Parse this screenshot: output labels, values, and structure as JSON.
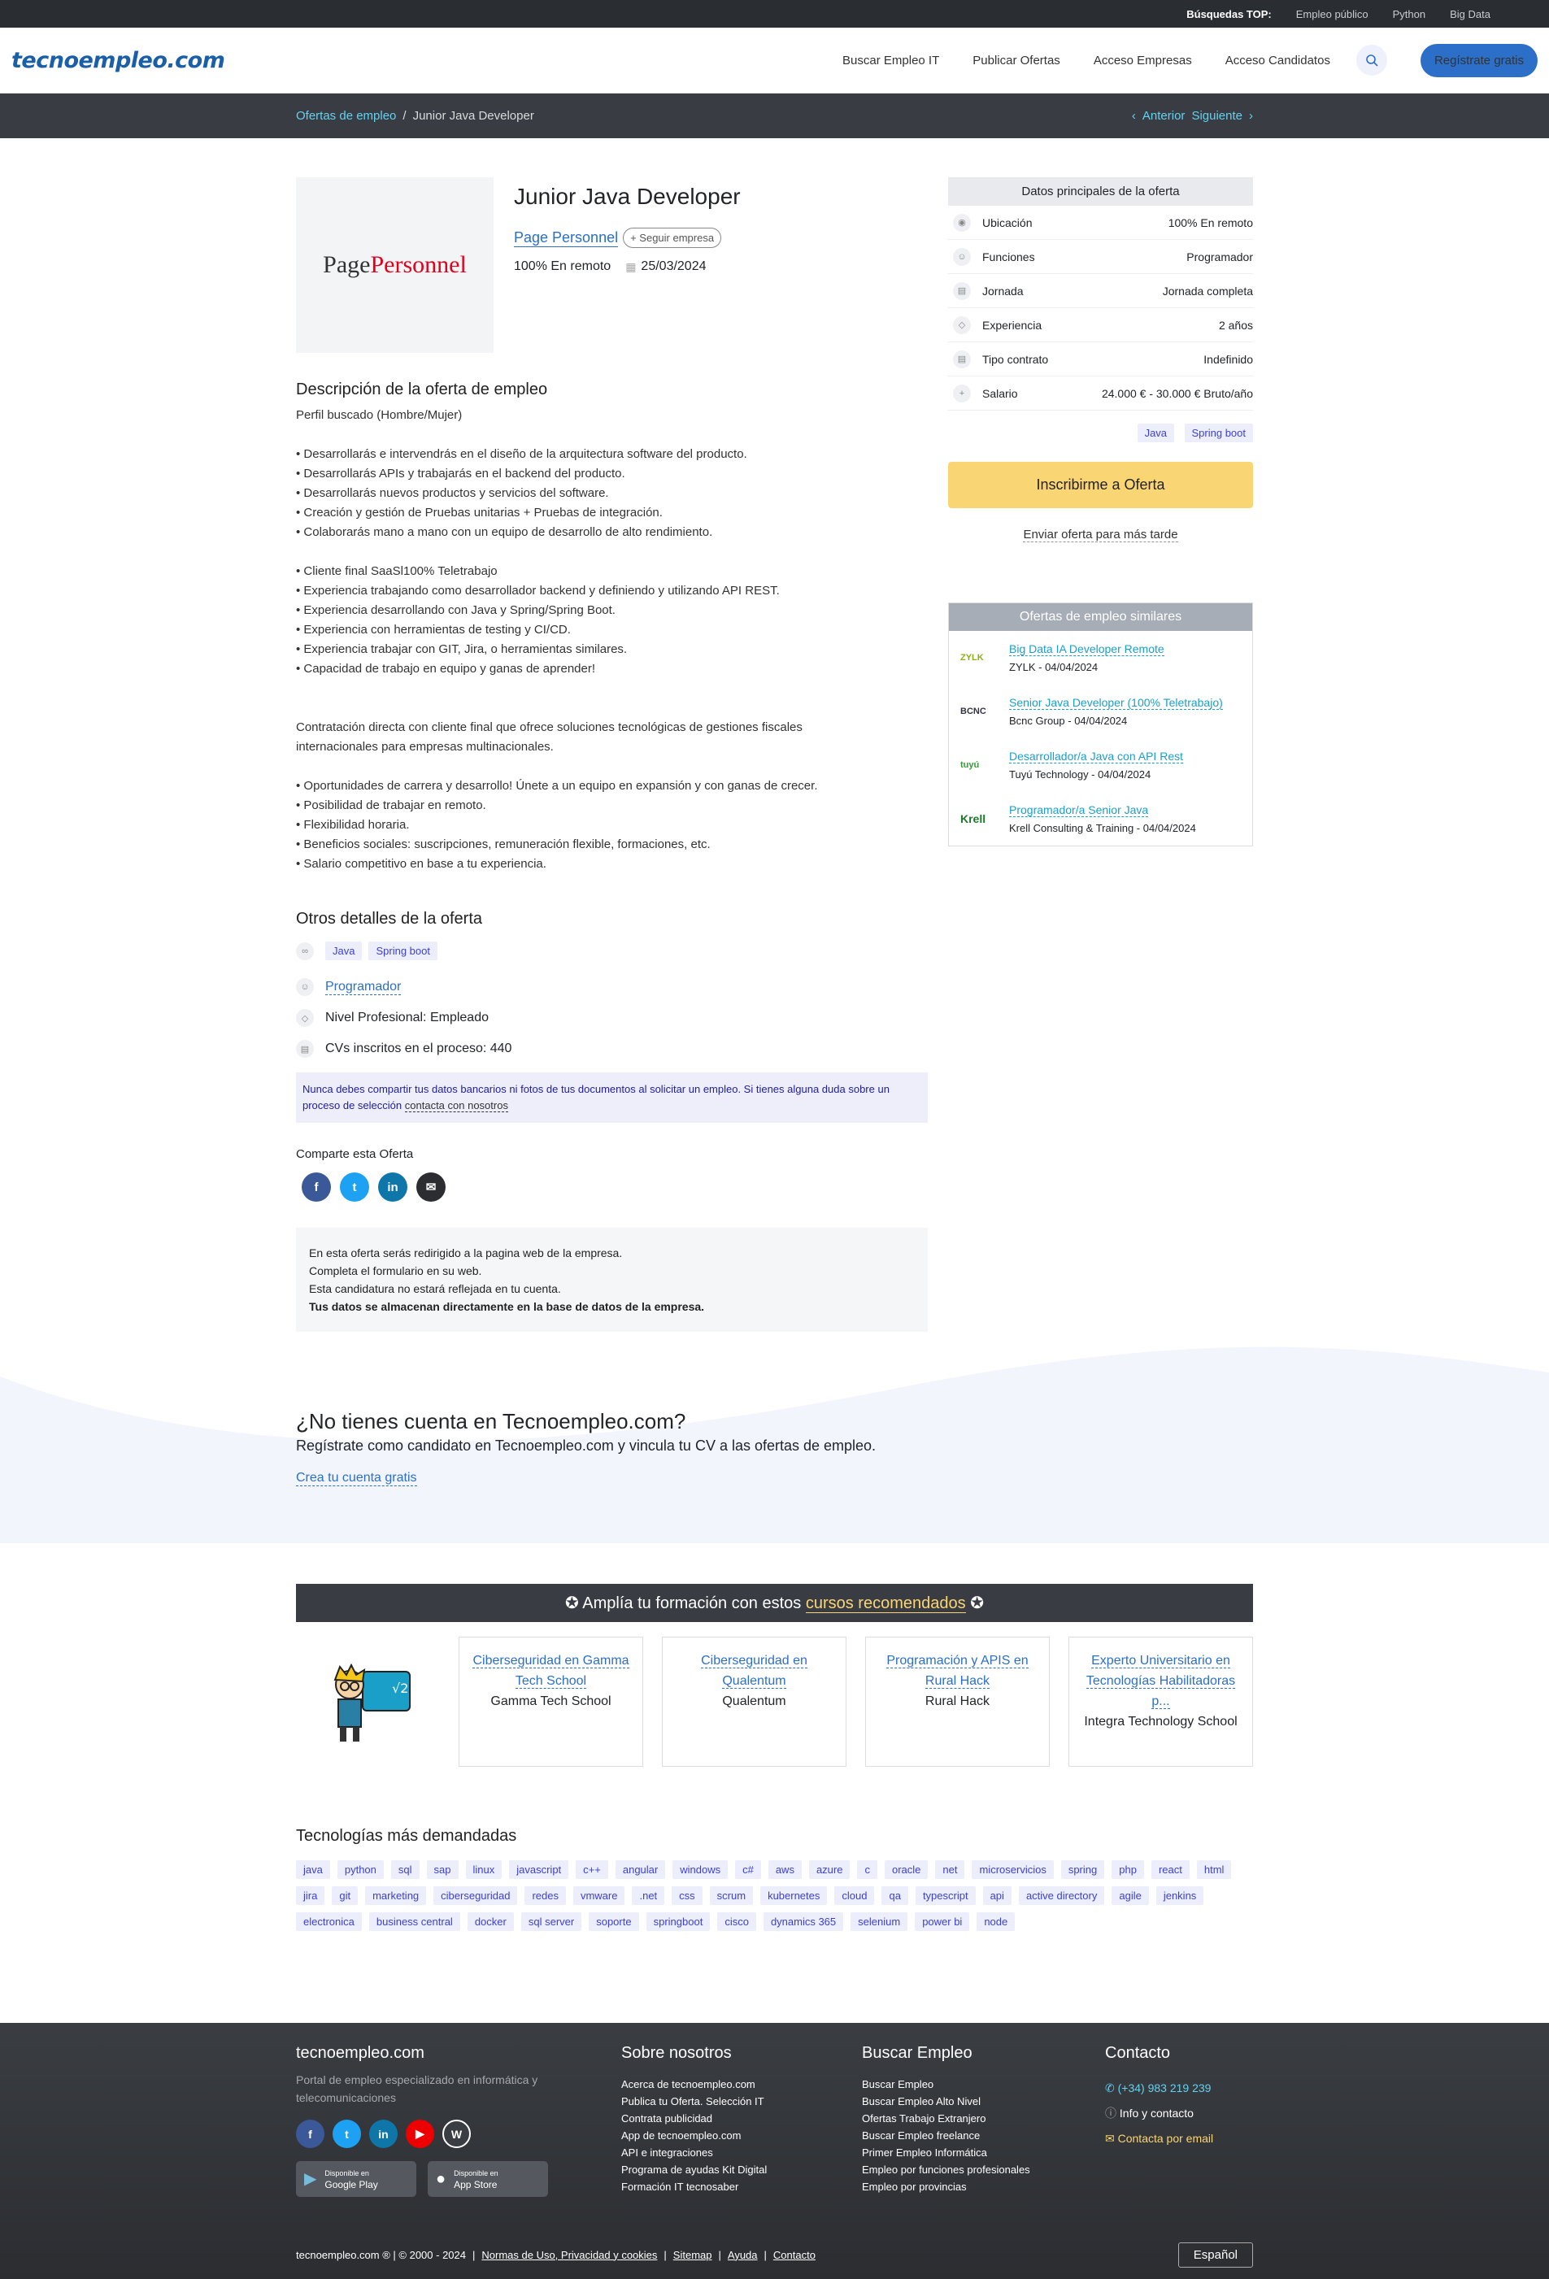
{
  "topbar": {
    "label": "Búsquedas TOP:",
    "links": [
      "Empleo público",
      "Python",
      "Big Data"
    ]
  },
  "header": {
    "logo": "tecnoempleo.com",
    "nav": [
      "Buscar Empleo IT",
      "Publicar Ofertas",
      "Acceso Empresas",
      "Acceso Candidatos"
    ],
    "register": "Regístrate gratis"
  },
  "breadcrumb": {
    "root": "Ofertas de empleo",
    "sep": "/",
    "current": "Junior Java Developer",
    "prev": "Anterior",
    "next": "Siguiente"
  },
  "job": {
    "title": "Junior Java Developer",
    "company": "Page Personnel",
    "logo_a": "Page",
    "logo_b": "Personnel",
    "follow": "+ Seguir empresa",
    "mode": "100% En remoto",
    "date": "25/03/2024"
  },
  "description": {
    "heading": "Descripción de la oferta de empleo",
    "profile": "Perfil buscado (Hombre/Mujer)",
    "block1": [
      "• Desarrollarás e intervendrás en el diseño de la arquitectura software del producto.",
      "• Desarrollarás APIs y trabajarás en el backend del producto.",
      "• Desarrollarás nuevos productos y servicios del software.",
      "• Creación y gestión de Pruebas unitarias + Pruebas de integración.",
      "• Colaborarás mano a mano con un equipo de desarrollo de alto rendimiento."
    ],
    "block2": [
      "• Cliente final SaaSl100% Teletrabajo",
      "• Experiencia trabajando como desarrollador backend y definiendo y utilizando API REST.",
      "• Experiencia desarrollando con Java y Spring/Spring Boot.",
      "• Experiencia con herramientas de testing y CI/CD.",
      "• Experiencia trabajar con GIT, Jira, o herramientas similares.",
      "• Capacidad de trabajo en equipo y ganas de aprender!"
    ],
    "block3": [
      "Contratación directa con cliente final que ofrece soluciones tecnológicas de gestiones fiscales",
      "internacionales para empresas multinacionales."
    ],
    "block4": [
      "• Oportunidades de carrera y desarrollo! Únete a un equipo en expansión y con ganas de crecer.",
      "• Posibilidad de trabajar en remoto.",
      "• Flexibilidad horaria.",
      "• Beneficios sociales: suscripciones, remuneración flexible, formaciones, etc.",
      "• Salario competitivo en base a tu experiencia."
    ]
  },
  "other": {
    "heading": "Otros detalles de la oferta",
    "tags": [
      "Java",
      "Spring boot"
    ],
    "role": "Programador",
    "level": "Nivel Profesional: Empleado",
    "cvs": "CVs inscritos en el proceso: 440",
    "warning": "Nunca debes compartir tus datos bancarios ni fotos de tus documentos al solicitar un empleo. Si tienes alguna duda sobre un proceso de selección",
    "warning_link": "contacta con nosotros",
    "share": "Comparte esta Oferta",
    "redirect": [
      "En esta oferta serás redirigido a la pagina web de la empresa.",
      "Completa el formulario en su web.",
      "Esta candidatura no estará reflejada en tu cuenta."
    ],
    "redirect_bold": "Tus datos se almacenan directamente en la base de datos de la empresa."
  },
  "sidebar": {
    "heading": "Datos principales de la oferta",
    "rows": [
      {
        "label": "Ubicación",
        "value": "100% En remoto"
      },
      {
        "label": "Funciones",
        "value": "Programador"
      },
      {
        "label": "Jornada",
        "value": "Jornada completa"
      },
      {
        "label": "Experiencia",
        "value": "2 años"
      },
      {
        "label": "Tipo contrato",
        "value": "Indefinido"
      },
      {
        "label": "Salario",
        "value": "24.000 € - 30.000 € Bruto/año"
      }
    ],
    "tags": [
      "Java",
      "Spring boot"
    ],
    "apply": "Inscribirme a Oferta",
    "later": "Enviar oferta para más tarde",
    "similar_heading": "Ofertas de empleo similares",
    "similar": [
      {
        "logo": "ZYLK",
        "title": "Big Data IA Developer Remote",
        "sub": "ZYLK - 04/04/2024"
      },
      {
        "logo": "BCNC",
        "title": "Senior Java Developer (100% Teletrabajo)",
        "sub": "Bcnc Group - 04/04/2024"
      },
      {
        "logo": "tuyú",
        "title": "Desarrollador/a Java con API Rest",
        "sub": "Tuyú Technology - 04/04/2024"
      },
      {
        "logo": "Krell",
        "title": "Programador/a Senior Java",
        "sub": "Krell Consulting & Training - 04/04/2024"
      }
    ]
  },
  "cta": {
    "title": "¿No tienes cuenta en Tecnoempleo.com?",
    "text": "Regístrate como candidato en Tecnoempleo.com y vincula tu CV a las ofertas de empleo.",
    "link": "Crea tu cuenta gratis"
  },
  "courses": {
    "head_a": "Amplía tu formación con estos",
    "head_b": "cursos recomendados",
    "items": [
      {
        "title": "Ciberseguridad en Gamma Tech School",
        "school": "Gamma Tech School"
      },
      {
        "title": "Ciberseguridad en Qualentum",
        "school": "Qualentum"
      },
      {
        "title": "Programación y APIS en Rural Hack",
        "school": "Rural Hack"
      },
      {
        "title": "Experto Universitario en Tecnologías Habilitadoras p...",
        "school": "Integra Technology School"
      }
    ]
  },
  "tech": {
    "heading": "Tecnologías más demandadas",
    "tags": [
      "java",
      "python",
      "sql",
      "sap",
      "linux",
      "javascript",
      "c++",
      "angular",
      "windows",
      "c#",
      "aws",
      "azure",
      "c",
      "oracle",
      "net",
      "microservicios",
      "spring",
      "php",
      "react",
      "html",
      "jira",
      "git",
      "marketing",
      "ciberseguridad",
      "redes",
      "vmware",
      ".net",
      "css",
      "scrum",
      "kubernetes",
      "cloud",
      "qa",
      "typescript",
      "api",
      "active directory",
      "agile",
      "jenkins",
      "electronica",
      "business central",
      "docker",
      "sql server",
      "soporte",
      "springboot",
      "cisco",
      "dynamics 365",
      "selenium",
      "power bi",
      "node"
    ]
  },
  "footer": {
    "brand": "tecnoempleo.com",
    "tagline": "Portal de empleo especializado en informática y telecomunicaciones",
    "store1_small": "Disponible en",
    "store1": "Google Play",
    "store2_small": "Disponible en",
    "store2": "App Store",
    "col2_title": "Sobre nosotros",
    "col2": [
      "Acerca de tecnoempleo.com",
      "Publica tu Oferta. Selección IT",
      "Contrata publicidad",
      "App de tecnoempleo.com",
      "API e integraciones",
      "Programa de ayudas Kit Digital",
      "Formación IT tecnosaber"
    ],
    "col3_title": "Buscar Empleo",
    "col3": [
      "Buscar Empleo",
      "Buscar Empleo Alto Nivel",
      "Ofertas Trabajo Extranjero",
      "Buscar Empleo freelance",
      "Primer Empleo Informática",
      "Empleo por funciones profesionales",
      "Empleo por provincias"
    ],
    "col4_title": "Contacto",
    "phone": "(+34) 983 219 239",
    "info": "Info y contacto",
    "email": "Contacta por email",
    "copyright": "tecnoempleo.com ® | © 2000 - 2024",
    "bottom_links": [
      "Normas de Uso, Privacidad y cookies",
      "Sitemap",
      "Ayuda",
      "Contacto"
    ],
    "lang": "Español"
  }
}
